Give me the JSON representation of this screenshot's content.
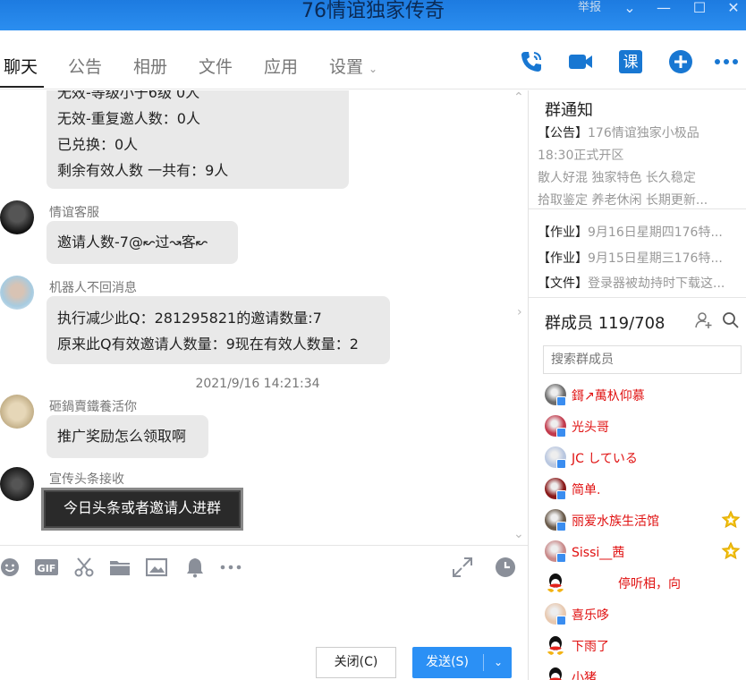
{
  "window": {
    "title": "76情谊独家传奇",
    "report_label": "举报"
  },
  "tabs": [
    "聊天",
    "公告",
    "相册",
    "文件",
    "应用",
    "设置"
  ],
  "toolbar_icons": [
    "phone-icon",
    "video-icon",
    "course-icon",
    "add-icon",
    "more-icon"
  ],
  "toolbar": {
    "course_label": "课"
  },
  "chat": {
    "messages": [
      {
        "sender": "",
        "lines": [
          "无效-等级小于6级 0人",
          "无效-重复邀人数：0人",
          "已兑换：0人",
          "剩余有效人数 一共有：9人"
        ]
      },
      {
        "sender": "情谊客服",
        "lines": [
          "邀请人数-7@↜过↝客↜"
        ]
      },
      {
        "sender": "机器人不回消息",
        "lines": [
          "执行减少此Q：281295821的邀请数量:7",
          "原来此Q有效邀请人数量：9现在有效人数量：2"
        ]
      },
      {
        "sender": "砸鍋賣鐵養活你",
        "lines": [
          "推广奖励怎么领取啊"
        ]
      },
      {
        "sender": "宣传头条接收",
        "lines": [
          "今日头条或者邀请人进群"
        ]
      }
    ],
    "timestamp": "2021/9/16 14:21:34"
  },
  "input_toolbar_icons": [
    "emoji-icon",
    "gif-icon",
    "scissors-icon",
    "folder-icon",
    "image-icon",
    "bell-icon",
    "more-icon",
    "expand-icon",
    "history-icon"
  ],
  "input_toolbar": {
    "gif_label": "GIF"
  },
  "buttons": {
    "close": "关闭(C)",
    "send": "发送(S)"
  },
  "notice": {
    "title": "群通知",
    "lines": [
      {
        "tag": "【公告】",
        "text": "176情谊独家小极品"
      },
      {
        "tag": "",
        "text": "18:30正式开区"
      },
      {
        "tag": "",
        "text": "散人好混 独家特色 长久稳定"
      },
      {
        "tag": "",
        "text": "拾取鉴定 养老休闲 长期更新..."
      }
    ],
    "items": [
      {
        "tag": "【作业】",
        "text": "9月16日星期四176特..."
      },
      {
        "tag": "【作业】",
        "text": "9月15日星期三176特..."
      },
      {
        "tag": "【文件】",
        "text": "登录器被劫持时下载这..."
      }
    ]
  },
  "members": {
    "title": "群成员 119/708",
    "search_placeholder": "搜索群成员",
    "list": [
      {
        "name": "鎶↗萬杁仰慕",
        "star": false,
        "avatar_color": "#6d6d6d"
      },
      {
        "name": "光头哥",
        "star": false,
        "avatar_color": "#c23a4c"
      },
      {
        "name": "JC している",
        "star": false,
        "avatar_color": "#b9c7e0"
      },
      {
        "name": "简单.",
        "star": false,
        "avatar_color": "#8a1a1a"
      },
      {
        "name": "丽爱水族生活馆",
        "star": true,
        "avatar_color": "#6a5b4b"
      },
      {
        "name": "Sissi__茜",
        "star": true,
        "avatar_color": "#c98a8a"
      },
      {
        "name": "停听相，向",
        "star": false,
        "avatar_color": "qq"
      },
      {
        "name": "喜乐哆",
        "star": false,
        "avatar_color": "#e8c9b0"
      },
      {
        "name": "下雨了",
        "star": false,
        "avatar_color": "qq"
      },
      {
        "name": "小猪",
        "star": false,
        "avatar_color": "qq"
      }
    ]
  },
  "colors": {
    "accent": "#2b90f5",
    "titlebar": "#1d7be0",
    "member_name": "#e01010",
    "bubble": "#e9e9e9"
  }
}
